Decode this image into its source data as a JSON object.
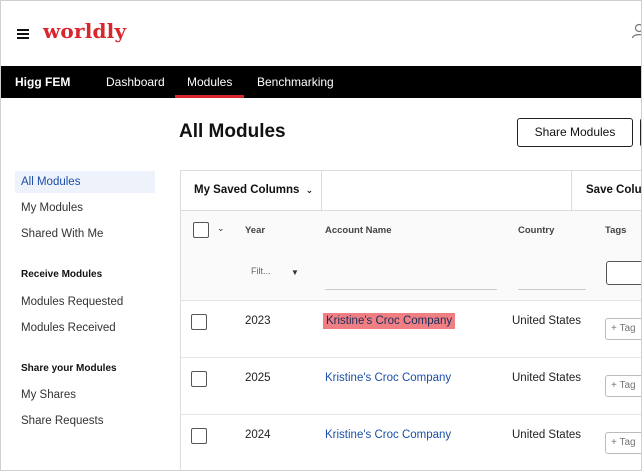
{
  "brand": {
    "logo_text": "worldly",
    "brand_color": "#d7262e"
  },
  "nav": {
    "app_name": "Higg FEM",
    "tabs": [
      {
        "label": "Dashboard"
      },
      {
        "label": "Modules",
        "active": true
      },
      {
        "label": "Benchmarking"
      }
    ]
  },
  "sidebar": {
    "items": [
      {
        "label": "All Modules",
        "active": true
      },
      {
        "label": "My Modules"
      },
      {
        "label": "Shared With Me"
      }
    ],
    "receive_heading": "Receive Modules",
    "receive_items": [
      {
        "label": "Modules Requested"
      },
      {
        "label": "Modules Received"
      }
    ],
    "share_heading": "Share your Modules",
    "share_items": [
      {
        "label": "My Shares"
      },
      {
        "label": "Share Requests"
      }
    ]
  },
  "main": {
    "title": "All Modules",
    "share_button": "Share Modules",
    "saved_columns": "My Saved Columns",
    "save_columns": "Save Columns",
    "columns": {
      "year": "Year",
      "account": "Account Name",
      "country": "Country",
      "tags": "Tags"
    },
    "year_filter_placeholder": "Filt...",
    "tag_button": "+ Tag",
    "rows": [
      {
        "year": "2023",
        "account": "Kristine's Croc Company",
        "country": "United States",
        "highlighted": true
      },
      {
        "year": "2025",
        "account": "Kristine's Croc Company",
        "country": "United States"
      },
      {
        "year": "2024",
        "account": "Kristine's Croc Company",
        "country": "United States"
      }
    ]
  },
  "colors": {
    "link": "#1b4fa8",
    "highlight": "#f07f83",
    "nav_bg": "#000000"
  }
}
